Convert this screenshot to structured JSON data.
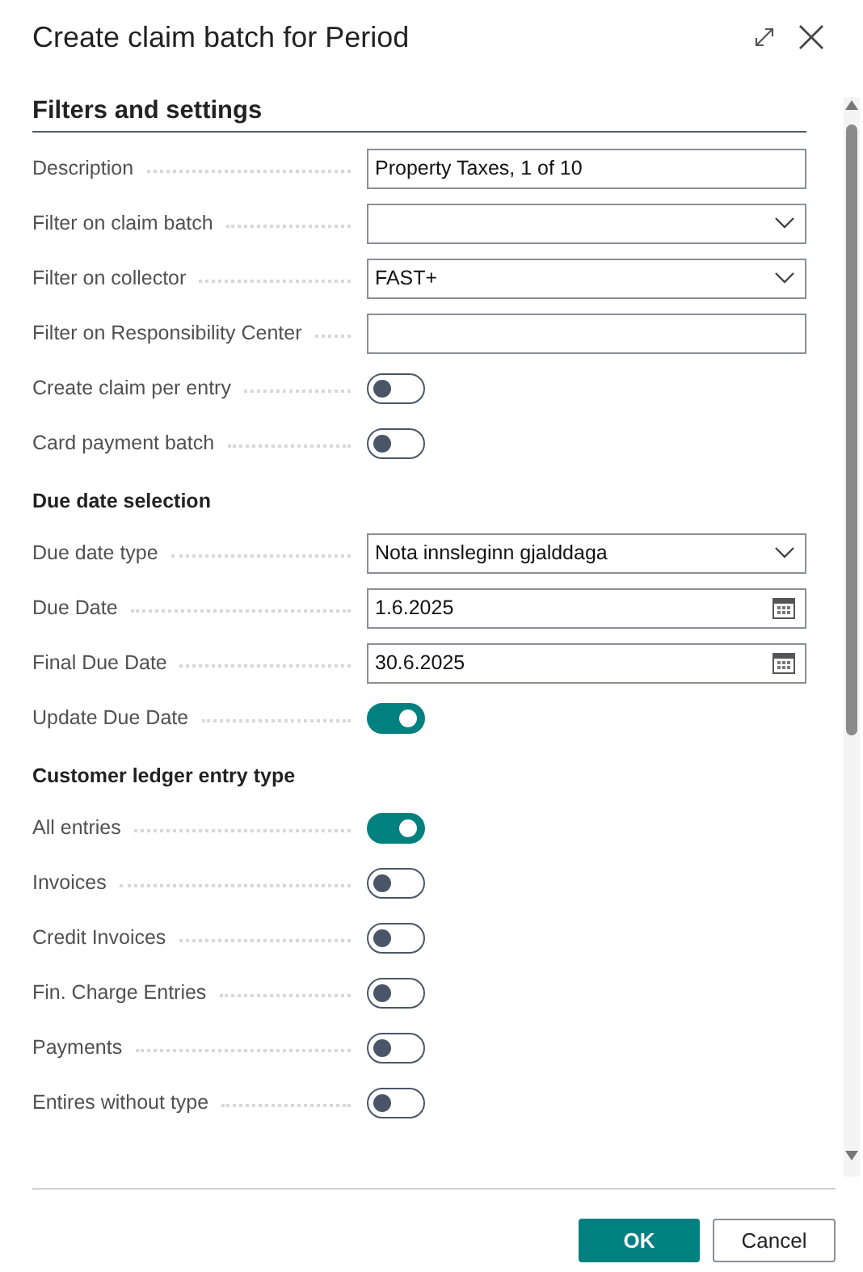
{
  "window": {
    "title": "Create claim batch for Period"
  },
  "section": {
    "title": "Filters and settings"
  },
  "rows": [
    {
      "kind": "text",
      "label": "Description",
      "value": "Property Taxes, 1 of 10"
    },
    {
      "kind": "dropdown",
      "label": "Filter on claim batch"
    },
    {
      "kind": "dropdown",
      "label": "Filter on collector",
      "value": "FAST+"
    },
    {
      "kind": "text",
      "label": "Filter on Responsibility Center"
    },
    {
      "kind": "toggle",
      "label": "Create claim per entry",
      "on": false
    },
    {
      "kind": "toggle",
      "label": "Card payment batch",
      "on": false
    },
    {
      "kind": "group",
      "label": "Due date selection"
    },
    {
      "kind": "dropdown",
      "label": "Due date type",
      "value": "Nota innsleginn gjalddaga"
    },
    {
      "kind": "date",
      "label": "Due Date",
      "value": "1.6.2025"
    },
    {
      "kind": "date",
      "label": "Final Due Date",
      "value": "30.6.2025"
    },
    {
      "kind": "toggle",
      "label": "Update Due Date",
      "on": true
    },
    {
      "kind": "group",
      "label": "Customer ledger entry type"
    },
    {
      "kind": "toggle",
      "label": "All entries",
      "on": true
    },
    {
      "kind": "toggle",
      "label": "Invoices",
      "on": false
    },
    {
      "kind": "toggle",
      "label": "Credit Invoices",
      "on": false
    },
    {
      "kind": "toggle",
      "label": "Fin. Charge Entries",
      "on": false
    },
    {
      "kind": "toggle",
      "label": "Payments",
      "on": false
    },
    {
      "kind": "toggle",
      "label": "Entires without type",
      "on": false
    }
  ],
  "buttons": [
    {
      "label": "OK",
      "kind": "primary"
    },
    {
      "label": "Cancel",
      "kind": "secondary"
    }
  ]
}
